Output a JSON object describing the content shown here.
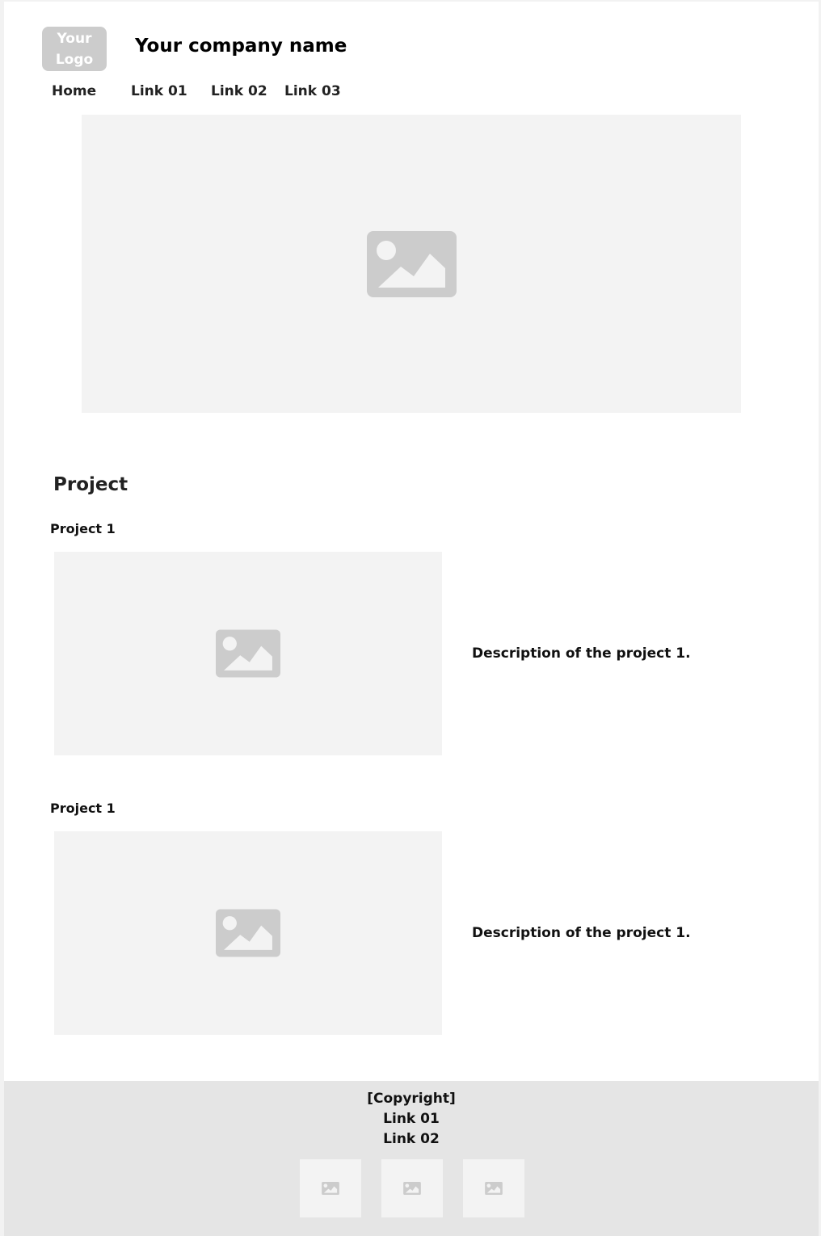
{
  "header": {
    "logo": [
      "Your",
      "Logo"
    ],
    "company_name": "Your company name"
  },
  "nav": {
    "items": [
      "Home",
      "Link 01",
      "Link 02",
      "Link 03"
    ]
  },
  "hero": {
    "icon": "image-placeholder-icon"
  },
  "projects": {
    "heading": "Project",
    "items": [
      {
        "title": "Project 1",
        "description": "Description of the project 1."
      },
      {
        "title": "Project 1",
        "description": "Description of the project 1."
      }
    ]
  },
  "footer": {
    "copyright": "[Copyright]",
    "links": [
      "Link 01",
      "Link 02"
    ]
  },
  "colors": {
    "placeholder_bg": "#f3f3f3",
    "icon": "#cccccc",
    "footer_bg": "#e5e5e5"
  }
}
